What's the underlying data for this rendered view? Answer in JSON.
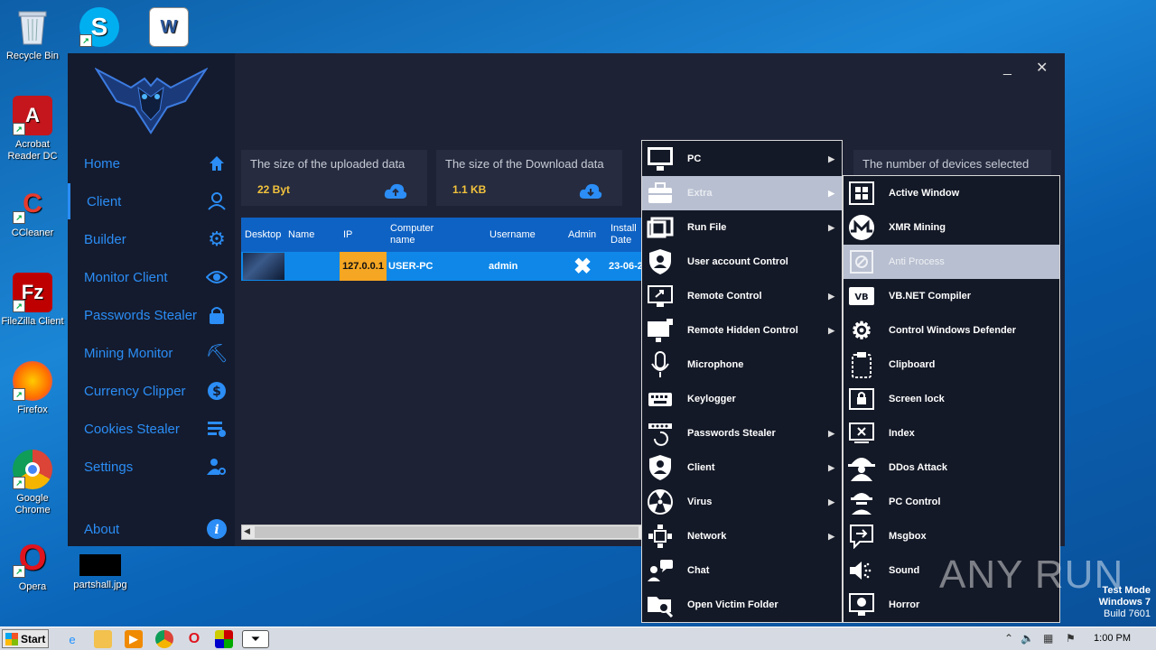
{
  "desktop": {
    "icons": [
      {
        "label": "Recycle Bin",
        "icon": "recycle-bin-icon"
      },
      {
        "label": "",
        "icon": "skype-icon"
      },
      {
        "label": "",
        "icon": "word-icon"
      },
      {
        "label": "Acrobat Reader DC",
        "icon": "acrobat-icon"
      },
      {
        "label": "CCleaner",
        "icon": "ccleaner-icon"
      },
      {
        "label": "FileZilla Client",
        "icon": "filezilla-icon"
      },
      {
        "label": "Firefox",
        "icon": "firefox-icon"
      },
      {
        "label": "Google Chrome",
        "icon": "chrome-icon"
      },
      {
        "label": "Opera",
        "icon": "opera-icon"
      },
      {
        "label": "partshall.jpg",
        "icon": "image-file-icon"
      }
    ]
  },
  "window": {
    "minimize": "_",
    "close": "✕"
  },
  "sidebar": {
    "items": [
      {
        "label": "Home",
        "icon": "home-icon"
      },
      {
        "label": "Client",
        "icon": "user-icon"
      },
      {
        "label": "Builder",
        "icon": "gear-icon"
      },
      {
        "label": "Monitor Client",
        "icon": "eye-icon"
      },
      {
        "label": "Passwords Stealer",
        "icon": "lock-icon"
      },
      {
        "label": "Mining Monitor",
        "icon": "pickaxe-icon"
      },
      {
        "label": "Currency Clipper",
        "icon": "currency-icon"
      },
      {
        "label": "Cookies Stealer",
        "icon": "cookie-list-icon"
      },
      {
        "label": "Settings",
        "icon": "user-settings-icon"
      },
      {
        "label": "About",
        "icon": "info-icon"
      }
    ]
  },
  "cards": {
    "uploaded": {
      "title": "The size of the uploaded data",
      "value": "22 Byt"
    },
    "download": {
      "title": "The size of the Download data",
      "value": "1.1 KB"
    },
    "devices": {
      "title": "The number of devices selected"
    }
  },
  "table": {
    "headers": [
      "Desktop",
      "Name",
      "IP",
      "Computer name",
      "Username",
      "Admin",
      "Install Date"
    ],
    "row": {
      "name": "",
      "ip": "127.0.0.1",
      "computer": "USER-PC",
      "username": "admin",
      "admin": "✖",
      "install": "23-06-2"
    }
  },
  "context_menu": {
    "items": [
      {
        "label": "PC",
        "sub": true
      },
      {
        "label": "Extra",
        "sub": true
      },
      {
        "label": "Run File",
        "sub": true
      },
      {
        "label": "User account Control",
        "sub": false
      },
      {
        "label": "Remote Control",
        "sub": true
      },
      {
        "label": "Remote Hidden Control",
        "sub": true
      },
      {
        "label": "Microphone",
        "sub": false
      },
      {
        "label": "Keylogger",
        "sub": false
      },
      {
        "label": "Passwords Stealer",
        "sub": true
      },
      {
        "label": "Client",
        "sub": true
      },
      {
        "label": "Virus",
        "sub": true
      },
      {
        "label": "Network",
        "sub": true
      },
      {
        "label": "Chat",
        "sub": false
      },
      {
        "label": "Open Victim Folder",
        "sub": false
      }
    ]
  },
  "submenu": {
    "items": [
      {
        "label": "Active Window"
      },
      {
        "label": "XMR Mining"
      },
      {
        "label": "Anti Process"
      },
      {
        "label": "VB.NET Compiler"
      },
      {
        "label": "Control Windows Defender"
      },
      {
        "label": "Clipboard"
      },
      {
        "label": "Screen lock"
      },
      {
        "label": "Index"
      },
      {
        "label": "DDos Attack"
      },
      {
        "label": "PC Control"
      },
      {
        "label": "Msgbox"
      },
      {
        "label": "Sound"
      },
      {
        "label": "Horror"
      }
    ]
  },
  "taskbar": {
    "start": "Start",
    "clock": "1:00 PM"
  },
  "watermark": {
    "line1": "Test Mode",
    "line2": "Windows 7",
    "line3": "Build 7601",
    "brand": "ANY RUN"
  }
}
